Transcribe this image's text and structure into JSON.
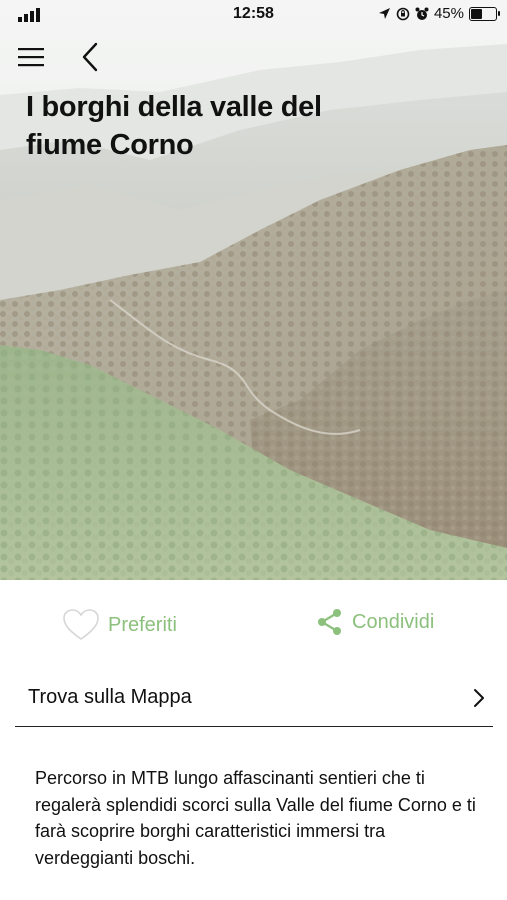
{
  "status_bar": {
    "time": "12:58",
    "battery_percent": "45%",
    "battery_level": 0.45,
    "icons": [
      "signal-icon",
      "location-arrow-icon",
      "rotation-lock-icon",
      "alarm-icon",
      "battery-icon"
    ]
  },
  "nav": {
    "menu_icon": "hamburger-menu-icon",
    "back_icon": "chevron-left-icon"
  },
  "hero": {
    "title": "I borghi della valle del fiume Corno",
    "image": "mountain-valley-forest-photo"
  },
  "actions": {
    "favorite_label": "Preferiti",
    "favorite_icon": "heart-outline-icon",
    "share_label": "Condividi",
    "share_icon": "share-icon",
    "accent_color": "#8cc07d"
  },
  "map_link": {
    "label": "Trova sulla Mappa",
    "icon": "chevron-right-icon"
  },
  "description": "Percorso in MTB lungo affascinanti sentieri che ti regalerà splendidi scorci sulla Valle del fiume Corno e ti farà scoprire borghi caratteristici immersi tra verdeggianti boschi."
}
